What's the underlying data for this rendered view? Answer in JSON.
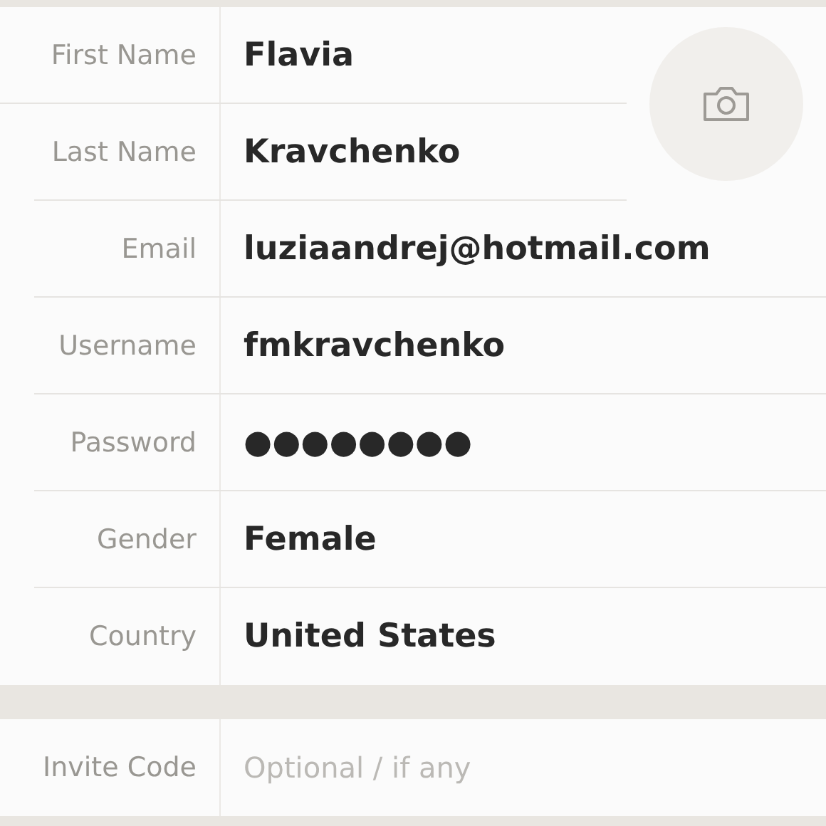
{
  "photo_button": {
    "kind": "camera"
  },
  "fields": [
    {
      "label": "First Name",
      "value": "Flavia"
    },
    {
      "label": "Last Name",
      "value": "Kravchenko"
    },
    {
      "label": "Email",
      "value": "luziaandrej@hotmail.com"
    },
    {
      "label": "Username",
      "value": "fmkravchenko"
    },
    {
      "label": "Password",
      "value": "●●●●●●●●"
    },
    {
      "label": "Gender",
      "value": "Female"
    },
    {
      "label": "Country",
      "value": "United States"
    }
  ],
  "invite": {
    "label": "Invite Code",
    "placeholder": "Optional / if any"
  }
}
